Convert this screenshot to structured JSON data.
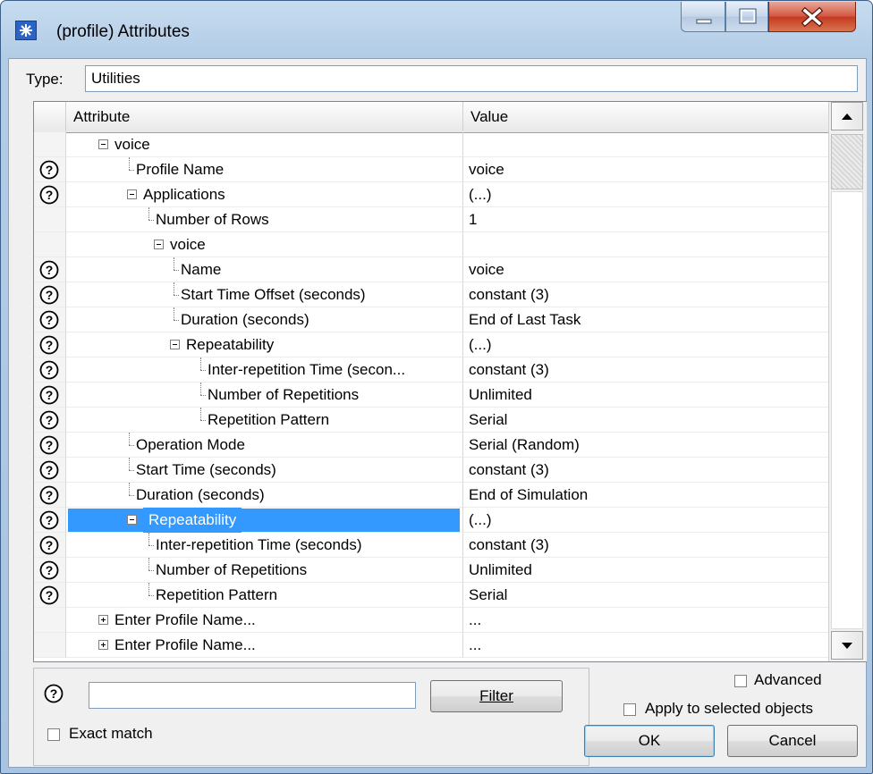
{
  "window": {
    "title": "(profile) Attributes"
  },
  "type_field": {
    "label": "Type:",
    "value": "Utilities"
  },
  "table": {
    "headers": {
      "attribute": "Attribute",
      "value": "Value"
    },
    "rows": [
      {
        "label": "voice",
        "value": ""
      },
      {
        "label": "Profile Name",
        "value": "voice"
      },
      {
        "label": "Applications",
        "value": "(...)"
      },
      {
        "label": "Number of Rows",
        "value": "1"
      },
      {
        "label": "voice",
        "value": ""
      },
      {
        "label": "Name",
        "value": "voice"
      },
      {
        "label": "Start Time Offset (seconds)",
        "value": "constant (3)"
      },
      {
        "label": "Duration (seconds)",
        "value": "End of Last Task"
      },
      {
        "label": "Repeatability",
        "value": "(...)"
      },
      {
        "label": "Inter-repetition Time (secon...",
        "value": "constant (3)"
      },
      {
        "label": "Number of Repetitions",
        "value": "Unlimited"
      },
      {
        "label": "Repetition Pattern",
        "value": "Serial"
      },
      {
        "label": "Operation Mode",
        "value": "Serial (Random)"
      },
      {
        "label": "Start Time (seconds)",
        "value": "constant (3)"
      },
      {
        "label": "Duration (seconds)",
        "value": "End of Simulation"
      },
      {
        "label": "Repeatability",
        "value": "(...)"
      },
      {
        "label": "Inter-repetition Time (seconds)",
        "value": "constant (3)"
      },
      {
        "label": "Number of Repetitions",
        "value": "Unlimited"
      },
      {
        "label": "Repetition Pattern",
        "value": "Serial"
      },
      {
        "label": "Enter Profile Name...",
        "value": "..."
      },
      {
        "label": "Enter Profile Name...",
        "value": "..."
      }
    ]
  },
  "filter": {
    "input_value": "",
    "button_label": "Filter",
    "exact_match_label": "Exact match",
    "exact_match_checked": false
  },
  "options": {
    "advanced_label": "Advanced",
    "advanced_checked": false,
    "apply_selected_label": "Apply to selected objects",
    "apply_selected_checked": false
  },
  "buttons": {
    "ok": "OK",
    "cancel": "Cancel"
  },
  "icons": {
    "help": "question-circle-icon",
    "app": "asterisk-star-icon",
    "minimize": "minimize-icon",
    "maximize": "maximize-icon",
    "close": "close-icon"
  },
  "colors": {
    "selection": "#3399ff",
    "close_button": "#c4391f"
  }
}
